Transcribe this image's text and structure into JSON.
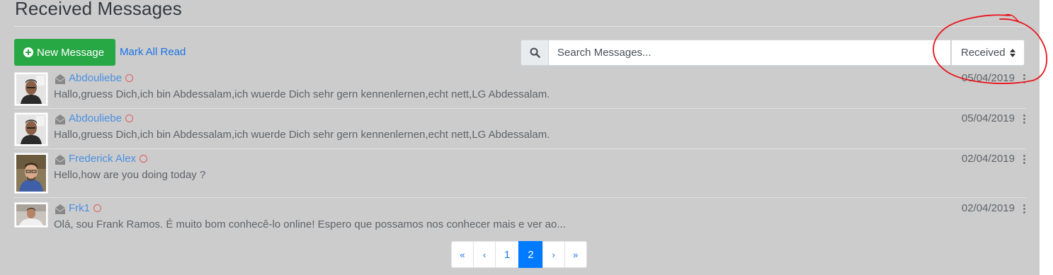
{
  "header": {
    "title": "Received Messages"
  },
  "toolbar": {
    "new_message_label": "New Message",
    "mark_all_read_label": "Mark All Read",
    "search_placeholder": "Search Messages...",
    "filter_selected": "Received"
  },
  "messages": [
    {
      "sender": "Abdouliebe",
      "date": "05/04/2019",
      "snippet": "Hallo,gruess Dich,ich bin Abdessalam,ich wuerde Dich sehr gern kennenlernen,echt nett,LG Abdessalam."
    },
    {
      "sender": "Abdouliebe",
      "date": "05/04/2019",
      "snippet": "Hallo,gruess Dich,ich bin Abdessalam,ich wuerde Dich sehr gern kennenlernen,echt nett,LG Abdessalam."
    },
    {
      "sender": "Frederick Alex",
      "date": "02/04/2019",
      "snippet": "Hello,how are you doing today ?"
    },
    {
      "sender": "Frk1",
      "date": "02/04/2019",
      "snippet": "Olá, sou Frank Ramos. É muito bom conhecê-lo online! Espero que possamos nos conhecer mais e ver ao..."
    }
  ],
  "pagination": {
    "first": "«",
    "prev": "‹",
    "pages": [
      "1",
      "2"
    ],
    "current": "2",
    "next": "›",
    "last": "»"
  },
  "colors": {
    "primary_button": "#28a745",
    "link": "#1a73e8",
    "sender_link": "#4a90e2",
    "active_page": "#007bff",
    "status_ring": "#e05c5c",
    "annotation": "#e8141b"
  }
}
